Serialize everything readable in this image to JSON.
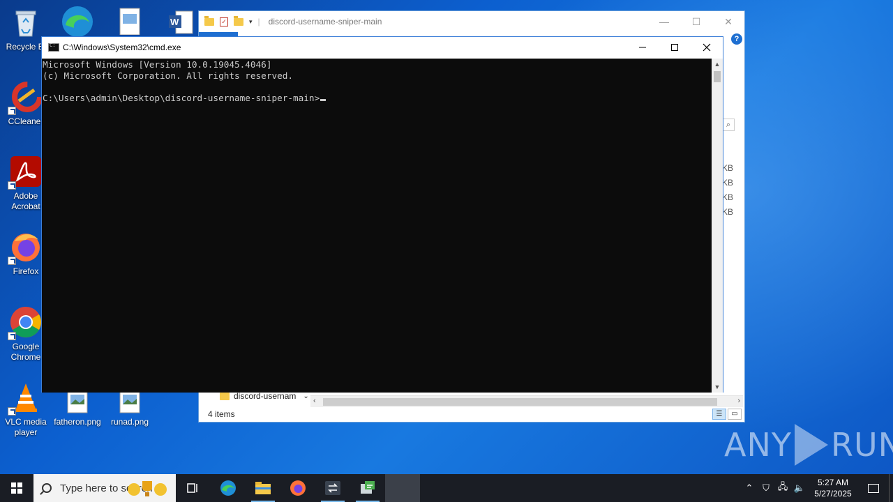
{
  "desktop": {
    "icons": [
      {
        "label": "Recycle Bin",
        "visible_label": "Recycle Bi"
      },
      {
        "label": "CCleaner"
      },
      {
        "label": "Adobe Acrobat",
        "visible_label": "Adobe\nAcrobat"
      },
      {
        "label": "Firefox"
      },
      {
        "label": "Google Chrome",
        "visible_label": "Google\nChrome"
      },
      {
        "label": "VLC media player",
        "visible_label": "VLC media\nplayer"
      },
      {
        "label": "fatheron.png"
      },
      {
        "label": "runad.png"
      }
    ]
  },
  "explorer": {
    "title": "discord-username-sniper-main",
    "sizes": [
      "KB",
      "KB",
      "KB",
      "KB"
    ],
    "nav_item": "discord-usernam",
    "status": "4 items",
    "help": "?"
  },
  "cmd": {
    "title": "C:\\Windows\\System32\\cmd.exe",
    "lines": [
      "Microsoft Windows [Version 10.0.19045.4046]",
      "(c) Microsoft Corporation. All rights reserved.",
      "",
      "C:\\Users\\admin\\Desktop\\discord-username-sniper-main>"
    ]
  },
  "watermark": {
    "left": "ANY",
    "right": "RUN"
  },
  "taskbar": {
    "search_placeholder": "Type here to search",
    "apps": [
      "task-view",
      "edge",
      "file-explorer",
      "firefox",
      "unknown-app",
      "cmd-app",
      "blank"
    ],
    "clock_time": "5:27 AM",
    "clock_date": "5/27/2025"
  },
  "colors": {
    "console_bg": "#0c0c0c",
    "console_fg": "#cccccc",
    "taskbar": "#1a1d24",
    "accent": "#1e6fd1"
  }
}
